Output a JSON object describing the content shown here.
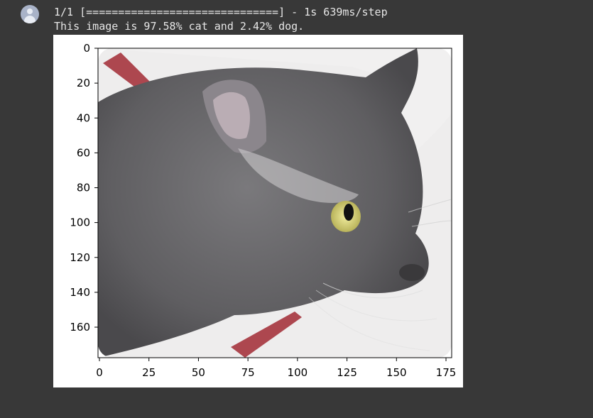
{
  "console": {
    "line1": "1/1 [==============================] - 1s 639ms/step",
    "line2": "This image is 97.58% cat and 2.42% dog."
  },
  "avatar_icon": "user-avatar-icon",
  "chart_data": {
    "type": "image",
    "x_ticks": [
      "0",
      "25",
      "50",
      "75",
      "100",
      "125",
      "150",
      "175"
    ],
    "y_ticks": [
      "0",
      "20",
      "40",
      "60",
      "80",
      "100",
      "120",
      "140",
      "160"
    ],
    "x_range": [
      0,
      180
    ],
    "y_range": [
      0,
      180
    ],
    "grid": false,
    "image_subject": "grey cat"
  },
  "colors": {
    "background": "#383838",
    "text": "#e6e6e6",
    "cat_grey": "#6f6e70",
    "stripe_red": "#a5343d"
  }
}
